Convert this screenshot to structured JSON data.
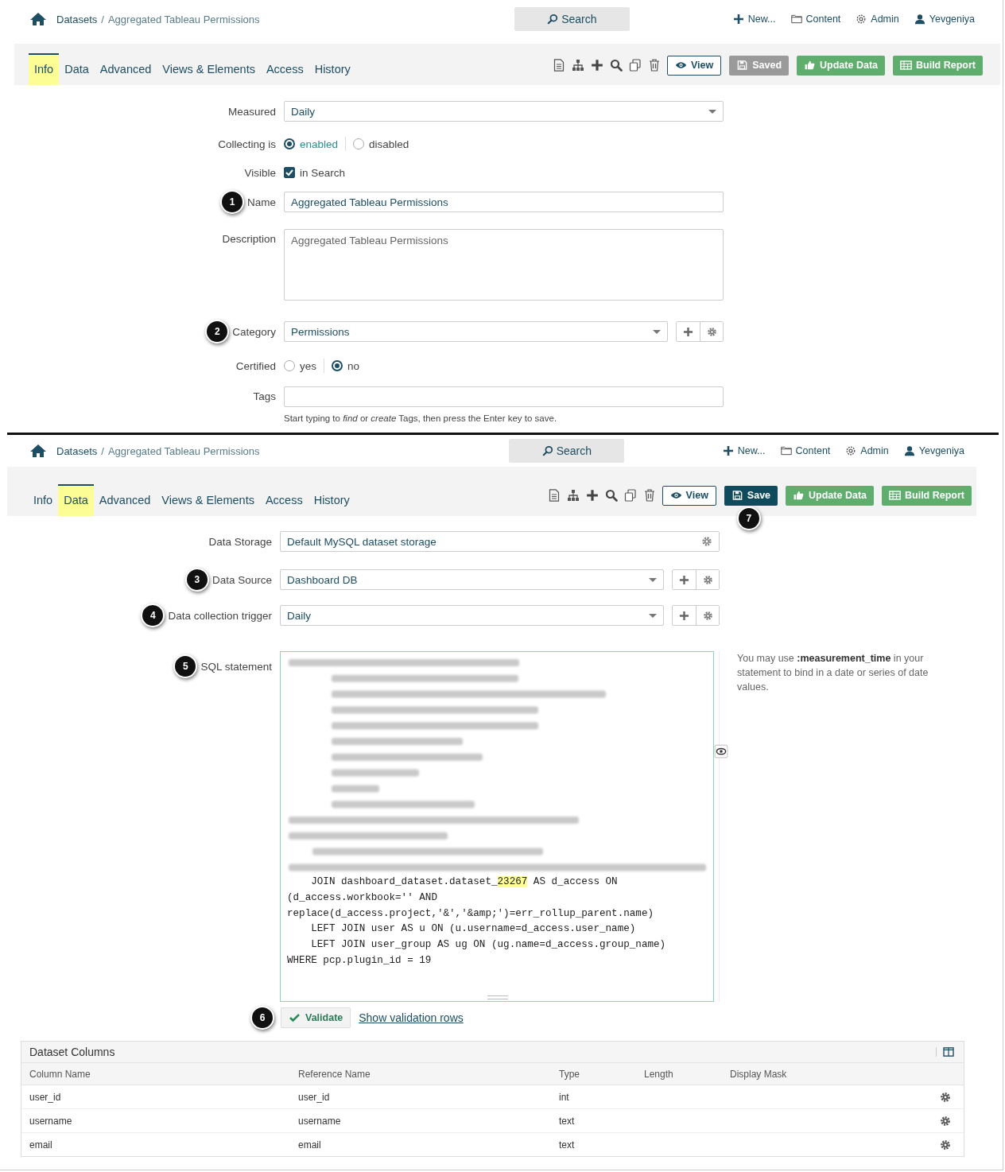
{
  "panels": [
    {
      "kind": "info",
      "breadcrumb": {
        "section": "Datasets",
        "separator": "/",
        "title": "Aggregated Tableau Permissions"
      },
      "search": "Search",
      "nav": [
        {
          "kind": "new",
          "label": "New..."
        },
        {
          "kind": "content",
          "label": "Content"
        },
        {
          "kind": "admin",
          "label": "Admin"
        },
        {
          "kind": "user",
          "label": "Yevgeniya"
        }
      ],
      "tabs": [
        {
          "label": "Info",
          "selected": true
        },
        {
          "label": "Data",
          "selected": false
        },
        {
          "label": "Advanced",
          "selected": false
        },
        {
          "label": "Views & Elements",
          "selected": false
        },
        {
          "label": "Access",
          "selected": false
        },
        {
          "label": "History",
          "selected": false
        }
      ],
      "buttons": [
        {
          "kind": "view",
          "label": "View",
          "disabled": false
        },
        {
          "kind": "save",
          "label": "Saved",
          "disabled": true
        },
        {
          "kind": "update",
          "label": "Update Data",
          "disabled": false
        },
        {
          "kind": "build",
          "label": "Build Report",
          "disabled": false
        }
      ],
      "form": [
        {
          "kind": "select",
          "label": "Measured",
          "value": "Daily"
        },
        {
          "kind": "radio",
          "label": "Collecting is",
          "options": [
            {
              "label": "enabled",
              "selected": true
            },
            {
              "label": "disabled",
              "selected": false
            }
          ]
        },
        {
          "kind": "checkbox",
          "label": "Visible",
          "option": "in Search",
          "checked": true
        },
        {
          "kind": "input",
          "label": "Name",
          "value": "Aggregated Tableau Permissions",
          "callout": "1"
        },
        {
          "kind": "textarea",
          "label": "Description",
          "placeholder": "Aggregated Tableau Permissions"
        },
        {
          "kind": "select-actions",
          "label": "Category",
          "value": "Permissions",
          "callout": "2"
        },
        {
          "kind": "radio",
          "label": "Certified",
          "options": [
            {
              "label": "yes",
              "selected": false
            },
            {
              "label": "no",
              "selected": true
            }
          ]
        },
        {
          "kind": "tags",
          "label": "Tags",
          "help": "Start typing to *find* or *create* Tags, then press the Enter key to save."
        }
      ]
    },
    {
      "kind": "data",
      "breadcrumb": {
        "section": "Datasets",
        "separator": "/",
        "title": "Aggregated Tableau Permissions"
      },
      "search": "Search",
      "nav": [
        {
          "kind": "new",
          "label": "New..."
        },
        {
          "kind": "content",
          "label": "Content"
        },
        {
          "kind": "admin",
          "label": "Admin"
        },
        {
          "kind": "user",
          "label": "Yevgeniya"
        }
      ],
      "tabs": [
        {
          "label": "Info",
          "selected": false
        },
        {
          "label": "Data",
          "selected": true
        },
        {
          "label": "Advanced",
          "selected": false
        },
        {
          "label": "Views & Elements",
          "selected": false
        },
        {
          "label": "Access",
          "selected": false
        },
        {
          "label": "History",
          "selected": false
        }
      ],
      "buttons": [
        {
          "kind": "view",
          "label": "View",
          "disabled": false
        },
        {
          "kind": "save",
          "label": "Save",
          "disabled": false,
          "callout": "7"
        },
        {
          "kind": "update",
          "label": "Update Data",
          "disabled": false
        },
        {
          "kind": "build",
          "label": "Build Report",
          "disabled": false
        }
      ],
      "form": [
        {
          "kind": "storage",
          "label": "Data Storage",
          "value": "Default MySQL dataset storage"
        },
        {
          "kind": "select-actions",
          "label": "Data Source",
          "value": "Dashboard DB",
          "callout": "3"
        },
        {
          "kind": "select-actions",
          "label": "Data collection trigger",
          "value": "Daily",
          "callout": "4"
        },
        {
          "kind": "sql",
          "label": "SQL statement",
          "callout": "5",
          "redacted": true,
          "lines": [
            [
              {
                "text": "    JOIN dashboard_dataset.dataset_",
                "highlighted": false
              },
              {
                "text": "23267",
                "highlighted": true
              },
              {
                "text": " AS d_access ON",
                "highlighted": false
              }
            ],
            [
              {
                "text": "(d_access.workbook='' AND",
                "highlighted": false
              }
            ],
            [
              {
                "text": "replace(d_access.project,'&','&amp;')=err_rollup_parent.name)",
                "highlighted": false
              }
            ],
            [
              {
                "text": "    LEFT JOIN user AS u ON (u.username=d_access.user_name)",
                "highlighted": false
              }
            ],
            [
              {
                "text": "    LEFT JOIN user_group AS ug ON (ug.name=d_access.group_name)",
                "highlighted": false
              }
            ],
            [
              {
                "text": "WHERE pcp.plugin_id = 19",
                "highlighted": false
              }
            ]
          ],
          "note": "You may use **:measurement_time** in your statement to bind in a date or series of date values."
        },
        {
          "kind": "validate",
          "button": "Validate",
          "link": "Show validation rows",
          "callout": "6"
        }
      ],
      "table": {
        "title": "Dataset Columns",
        "columns": [
          "Column Name",
          "Reference Name",
          "Type",
          "Length",
          "Display Mask"
        ],
        "rows": [
          [
            "user_id",
            "user_id",
            "int",
            "",
            ""
          ],
          [
            "username",
            "username",
            "text",
            "",
            ""
          ],
          [
            "email",
            "email",
            "text",
            "",
            ""
          ]
        ]
      }
    }
  ]
}
